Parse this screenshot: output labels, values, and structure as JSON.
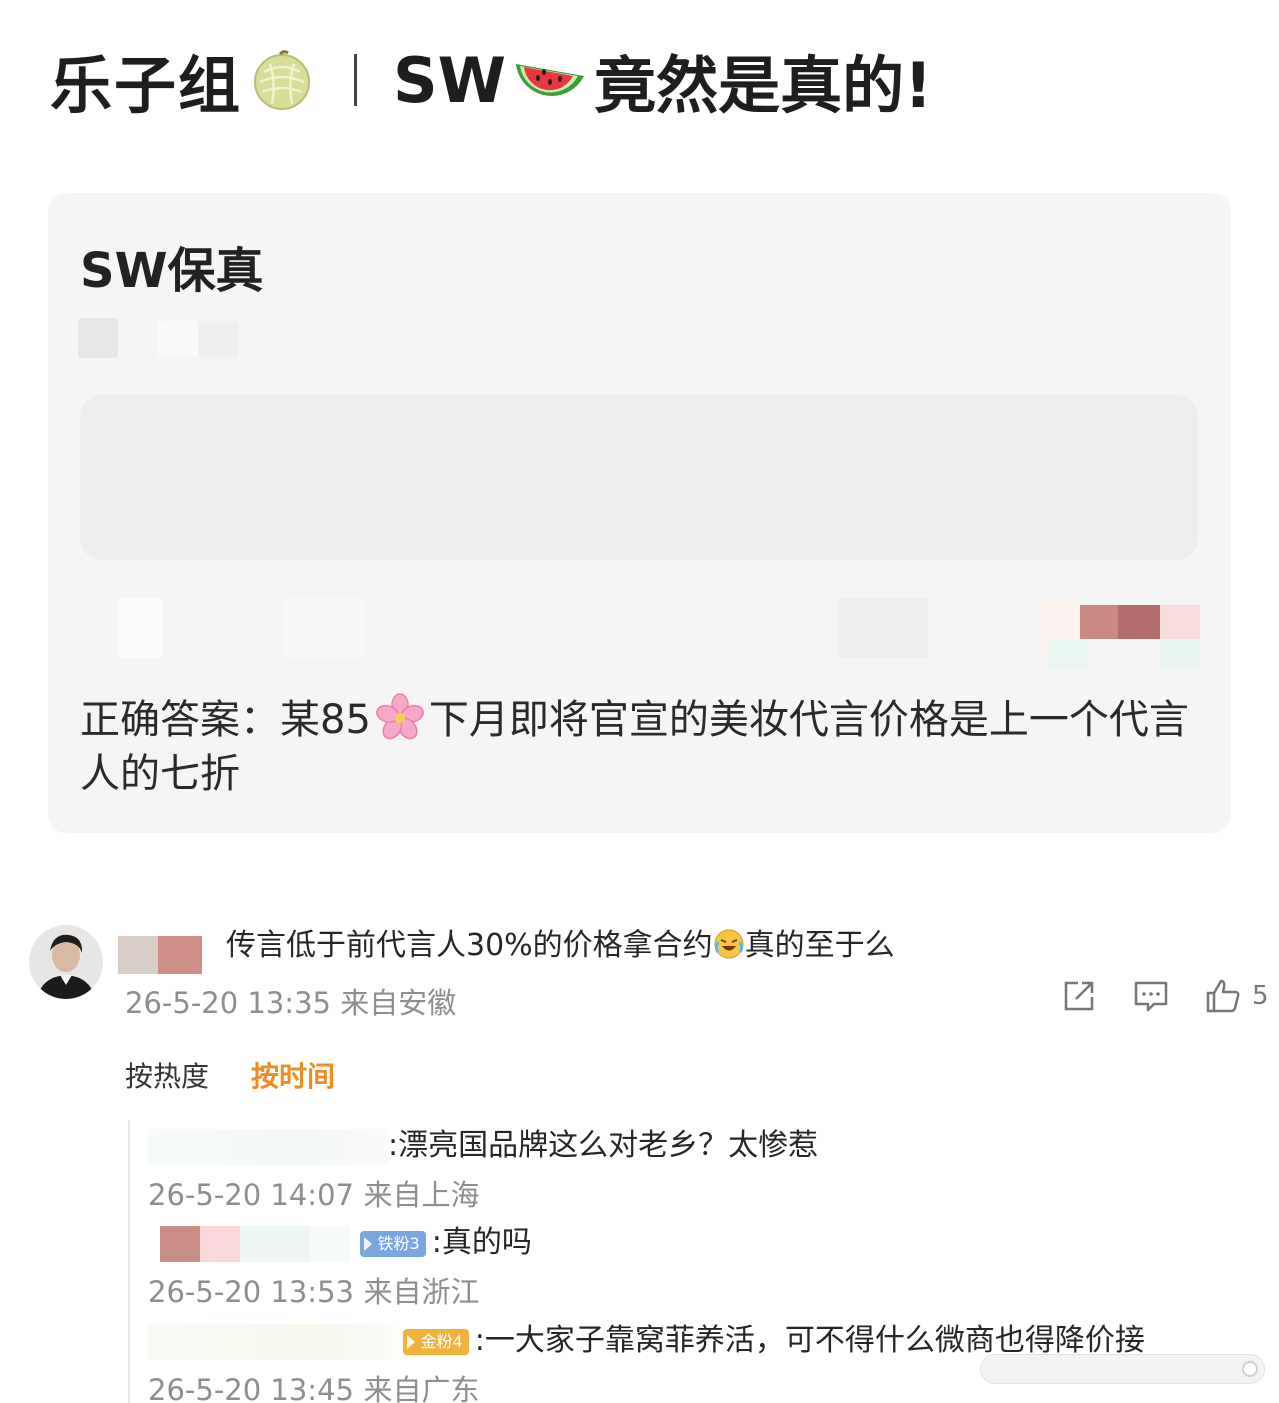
{
  "header": {
    "group_name": "乐子组",
    "title_prefix": "SW",
    "title_suffix": "竟然是真的!",
    "melon_icon": "melon-emoji",
    "watermelon_icon": "watermelon-emoji"
  },
  "card": {
    "title": "SW保真",
    "answer_prefix": "正确答案：某85",
    "answer_suffix": "下月即将官宣的美妆代言价格是上一个代言人的七折",
    "flower_icon": "cherry-blossom-emoji"
  },
  "comment": {
    "text_prefix": "传言低于前代言人30%的价格拿合约",
    "text_suffix": "真的至于么",
    "emoji": "laughing-crying-emoji",
    "time": "26-5-20 13:35",
    "location": "来自安徽",
    "likes": "5"
  },
  "sort_tabs": [
    {
      "label": "按热度",
      "active": false
    },
    {
      "label": "按时间",
      "active": true
    }
  ],
  "replies": [
    {
      "text": ":漂亮国品牌这么对老乡？太惨惹",
      "badge": "",
      "time": "26-5-20 14:07",
      "location": "来自上海"
    },
    {
      "text": ":真的吗",
      "badge": "铁粉3",
      "time": "26-5-20 13:53",
      "location": "来自浙江"
    },
    {
      "text": ":一大家子靠窝菲养活，可不得什么微商也得降价接",
      "badge": "金粉4",
      "time": "26-5-20 13:45",
      "location": "来自广东"
    }
  ],
  "colors": {
    "accent_orange": "#f08a24",
    "card_bg": "#f5f5f5",
    "meta_gray": "#8e8e8e",
    "badge_iron": "#7aa6e0",
    "badge_gold": "#f0b23c"
  }
}
